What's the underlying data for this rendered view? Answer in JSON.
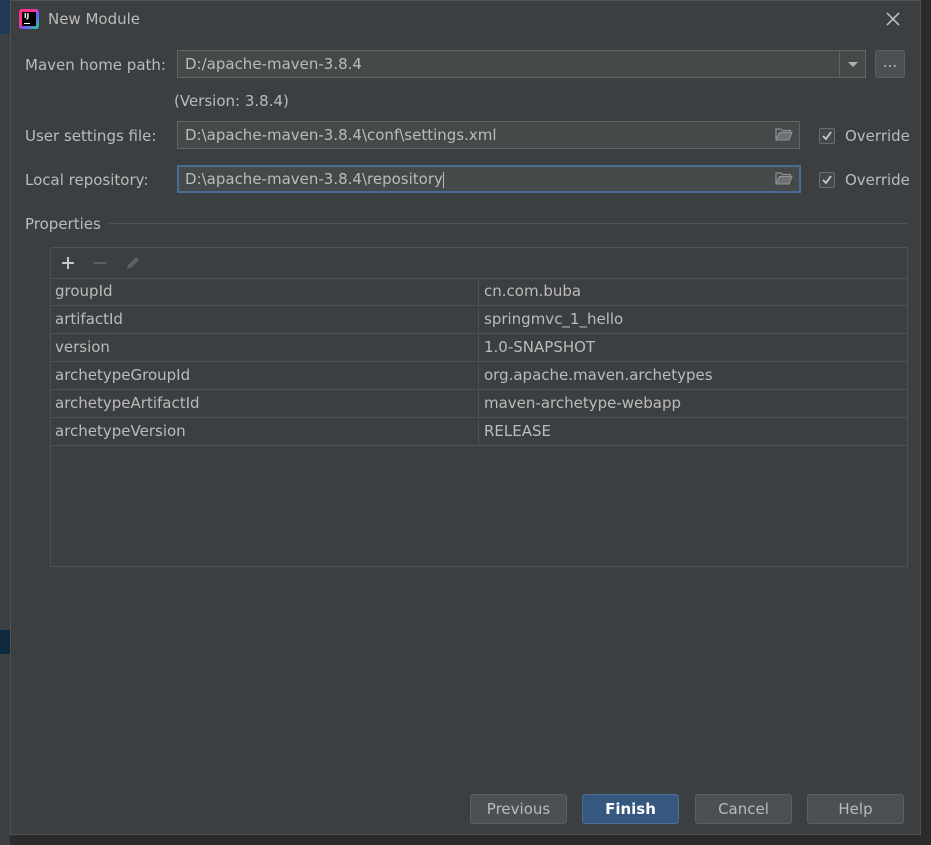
{
  "window": {
    "title": "New Module"
  },
  "maven": {
    "home_label": "Maven home path:",
    "home_value": "D:/apache-maven-3.8.4",
    "browse_label": "...",
    "version_text": "(Version: 3.8.4)",
    "settings_label": "User settings file:",
    "settings_value": "D:\\apache-maven-3.8.4\\conf\\settings.xml",
    "settings_override": "Override",
    "repo_label": "Local repository:",
    "repo_value": "D:\\apache-maven-3.8.4\\repository",
    "repo_override": "Override"
  },
  "properties": {
    "title": "Properties",
    "rows": [
      {
        "key": "groupId",
        "value": "cn.com.buba"
      },
      {
        "key": "artifactId",
        "value": "springmvc_1_hello"
      },
      {
        "key": "version",
        "value": "1.0-SNAPSHOT"
      },
      {
        "key": "archetypeGroupId",
        "value": "org.apache.maven.archetypes"
      },
      {
        "key": "archetypeArtifactId",
        "value": "maven-archetype-webapp"
      },
      {
        "key": "archetypeVersion",
        "value": "RELEASE"
      }
    ]
  },
  "buttons": {
    "previous": "Previous",
    "finish": "Finish",
    "cancel": "Cancel",
    "help": "Help"
  },
  "colors": {
    "dialog_bg": "#3c3f41",
    "field_bg": "#45494a",
    "focus_border": "#466d94",
    "primary_button": "#365880"
  }
}
